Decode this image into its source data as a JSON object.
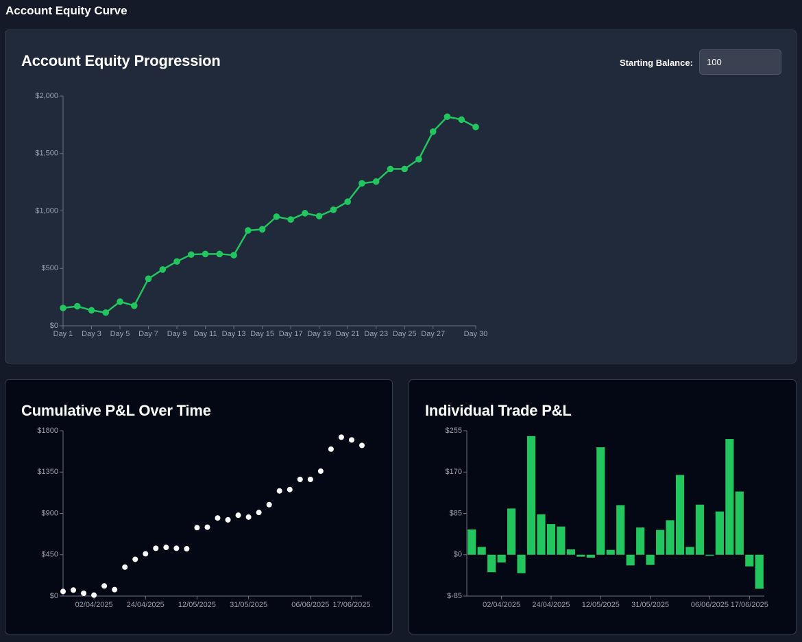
{
  "header": {
    "title": "Account Equity Curve"
  },
  "equity_card": {
    "title": "Account Equity Progression",
    "balance_label": "Starting Balance:",
    "balance_value": "100"
  },
  "cumulative_card": {
    "title": "Cumulative P&L Over Time"
  },
  "trade_card": {
    "title": "Individual Trade P&L"
  },
  "colors": {
    "green": "#22c55e",
    "white_dot": "#ffffff",
    "axis": "#6b7280",
    "tick_text": "#9ca3af"
  },
  "chart_data": [
    {
      "type": "line",
      "x_tick_labels": [
        "Day 1",
        "Day 3",
        "Day 5",
        "Day 7",
        "Day 9",
        "Day 11",
        "Day 13",
        "Day 15",
        "Day 17",
        "Day 19",
        "Day 21",
        "Day 23",
        "Day 25",
        "Day 27",
        "Day 30"
      ],
      "y_tick_labels": [
        "$0",
        "$500",
        "$1,000",
        "$1,500",
        "$2,000"
      ],
      "ylim": [
        0,
        2000
      ],
      "x": [
        1,
        2,
        3,
        4,
        5,
        6,
        7,
        8,
        9,
        10,
        11,
        12,
        13,
        14,
        15,
        16,
        17,
        18,
        19,
        20,
        21,
        22,
        23,
        24,
        25,
        26,
        27,
        28,
        29,
        30
      ],
      "values": [
        155,
        170,
        135,
        115,
        210,
        175,
        410,
        490,
        560,
        620,
        625,
        625,
        615,
        830,
        840,
        950,
        925,
        980,
        955,
        1010,
        1080,
        1240,
        1255,
        1365,
        1365,
        1450,
        1690,
        1820,
        1795,
        1730
      ],
      "color": "#22c55e"
    },
    {
      "type": "scatter",
      "x_tick_labels": [
        "02/04/2025",
        "24/04/2025",
        "12/05/2025",
        "31/05/2025",
        "06/06/2025",
        "17/06/2025"
      ],
      "y_tick_labels": [
        "$0",
        "$450",
        "$900",
        "$1350",
        "$1800"
      ],
      "ylim": [
        0,
        1800
      ],
      "values": [
        50,
        65,
        30,
        10,
        110,
        70,
        315,
        400,
        460,
        520,
        530,
        520,
        515,
        745,
        750,
        850,
        830,
        880,
        860,
        910,
        995,
        1145,
        1160,
        1270,
        1270,
        1360,
        1600,
        1730,
        1700,
        1640
      ],
      "color": "#ffffff"
    },
    {
      "type": "bar",
      "x_tick_labels": [
        "02/04/2025",
        "24/04/2025",
        "12/05/2025",
        "31/05/2025",
        "06/06/2025",
        "17/06/2025"
      ],
      "y_tick_labels": [
        "$255",
        "$170",
        "$85",
        "$0",
        "$-85"
      ],
      "ylim": [
        -85,
        255
      ],
      "values": [
        52,
        16,
        -36,
        -16,
        95,
        -38,
        244,
        83,
        63,
        58,
        11,
        -4,
        -6,
        221,
        10,
        102,
        -22,
        56,
        -21,
        51,
        71,
        164,
        16,
        103,
        -2,
        89,
        238,
        130,
        -24,
        -70
      ],
      "color": "#22c55e"
    }
  ]
}
